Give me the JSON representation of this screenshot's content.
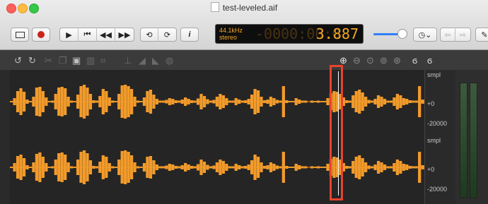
{
  "window": {
    "title": "test-leveled.aif"
  },
  "display": {
    "format_top": "44.1kHz",
    "format_bottom": "stereo",
    "time_dim": "-0000:00:0",
    "time_value": "3.887"
  },
  "toolbar": {
    "info_label": "i"
  },
  "scale": {
    "unit": "smpl",
    "zero": "+0",
    "neg": "-20000"
  },
  "colors": {
    "waveform": "#f29b2b",
    "selection": "#e8432d",
    "lcd": "#f5a623"
  },
  "waveform_top": [
    2,
    10,
    30,
    38,
    28,
    6,
    2,
    14,
    40,
    42,
    30,
    12,
    2,
    3,
    22,
    40,
    42,
    38,
    14,
    3,
    2,
    20,
    44,
    48,
    40,
    22,
    4,
    3,
    16,
    36,
    30,
    12,
    3,
    2,
    22,
    46,
    48,
    44,
    36,
    14,
    3,
    2,
    12,
    30,
    34,
    20,
    8,
    3,
    3,
    5,
    10,
    8,
    4,
    3,
    6,
    12,
    8,
    4,
    3,
    9,
    22,
    16,
    7,
    3,
    5,
    14,
    22,
    18,
    10,
    3,
    3,
    10,
    6,
    3,
    4,
    8,
    20,
    36,
    32,
    14,
    4,
    6,
    14,
    10,
    5,
    3,
    44,
    4,
    2,
    2,
    10,
    6,
    3,
    3,
    1,
    3,
    2,
    3,
    2,
    2,
    10,
    24,
    30,
    28,
    22,
    12,
    4,
    3,
    18,
    30,
    34,
    26,
    14,
    5,
    3,
    8,
    18,
    14,
    8,
    3,
    3,
    12,
    22,
    18,
    10,
    8,
    4,
    3,
    3,
    44,
    6
  ],
  "waveform_bottom": [
    2,
    12,
    32,
    36,
    26,
    6,
    2,
    14,
    38,
    42,
    30,
    12,
    2,
    3,
    22,
    40,
    42,
    36,
    14,
    3,
    2,
    22,
    44,
    48,
    40,
    20,
    4,
    3,
    16,
    34,
    30,
    12,
    3,
    2,
    22,
    46,
    48,
    44,
    34,
    14,
    3,
    2,
    12,
    30,
    32,
    20,
    8,
    3,
    3,
    5,
    10,
    8,
    4,
    3,
    6,
    12,
    8,
    4,
    3,
    9,
    22,
    16,
    7,
    3,
    5,
    14,
    22,
    18,
    10,
    3,
    3,
    10,
    6,
    3,
    4,
    8,
    20,
    36,
    30,
    14,
    4,
    6,
    14,
    10,
    5,
    3,
    44,
    4,
    2,
    2,
    10,
    6,
    3,
    3,
    1,
    3,
    2,
    3,
    2,
    2,
    10,
    24,
    30,
    28,
    22,
    12,
    4,
    3,
    18,
    30,
    34,
    26,
    14,
    5,
    3,
    8,
    18,
    14,
    8,
    3,
    3,
    12,
    22,
    18,
    10,
    8,
    4,
    3,
    3,
    44,
    6
  ]
}
